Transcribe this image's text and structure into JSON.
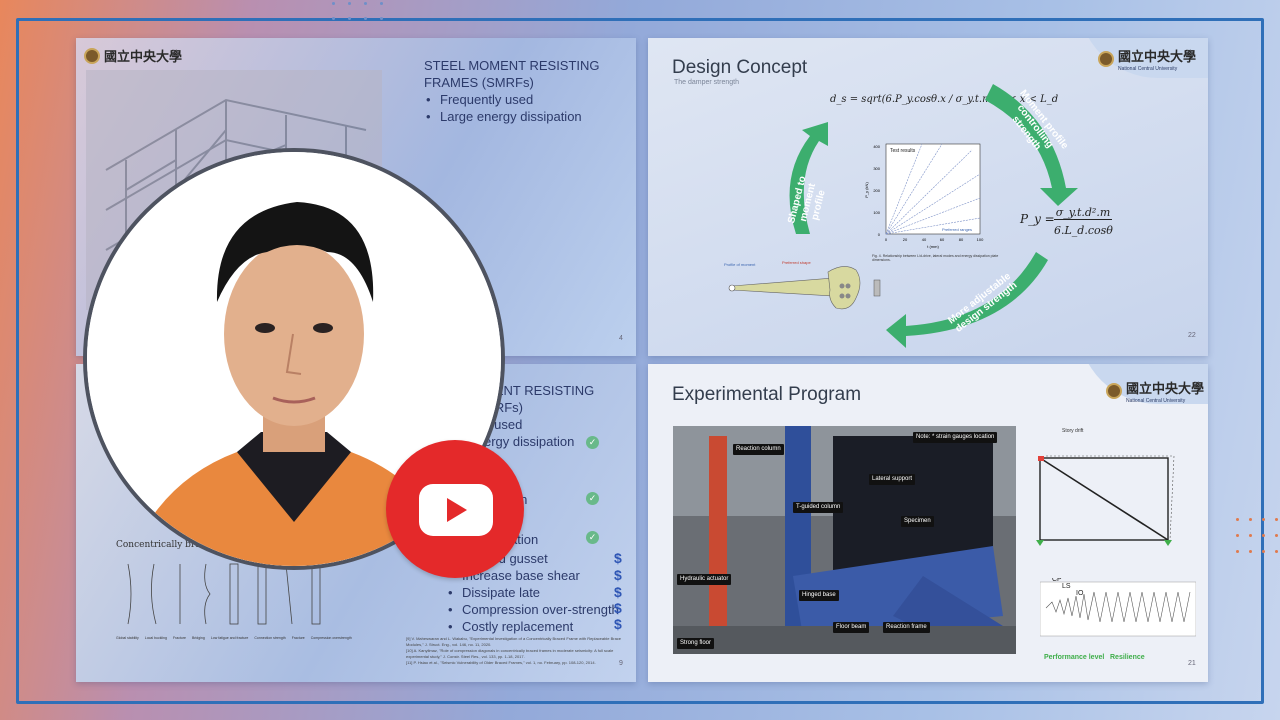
{
  "slide_a": {
    "heading": "STEEL MOMENT RESISTING FRAMES (SMRFs)",
    "bullets": [
      "Frequently used",
      "Large energy dissipation"
    ],
    "page_number": "4"
  },
  "slide_b": {
    "title": "Design Concept",
    "subtitle": "The damper strength",
    "cycle_labels": [
      "Moment profile controlling strength",
      "More adjustable design strength",
      "Shaped to moment profile"
    ],
    "chart_legend": "Test results",
    "chart_xlabel": "t (mm)",
    "chart_ylabel": "P_y (kN)",
    "chart_yticks": [
      "400",
      "300",
      "200",
      "100",
      "0"
    ],
    "chart_xticks": [
      "0",
      "20",
      "40",
      "60",
      "80",
      "100"
    ],
    "chart_note": "Preferred ranges",
    "figure_caption": "Fig. 4. Relationship between L/d-drive, lateral modes and energy dissipation plate dimensions.",
    "diagram_labels": [
      "Profile of moment",
      "Preferred shape"
    ],
    "formula_left": "d_s = sqrt(6.P_y.cosθ.x / σ_y.t.m) 0 < x < L_d",
    "formula_right_num": "σ_y.t.d².m",
    "formula_right_den": "6.L_d.cosθ",
    "formula_right_lhs": "P_y =",
    "page_number": "22"
  },
  "slide_c": {
    "heading_lines": [
      "MENT RESISTING",
      "MRFs)"
    ],
    "bullets_partial": [
      "y used",
      "ergy dissipation"
    ],
    "section2_partial": [
      "ES",
      "rmation",
      "ATED",
      "issipation"
    ],
    "bullets": [
      "Welded gusset",
      "Increase base shear",
      "Dissipate late",
      "Compression over-strength",
      "Costly replacement"
    ],
    "caption_left": "Concentrically braced Frame (CBF)",
    "brace_labels": [
      "Global stability",
      "Local buckling",
      "Fracture",
      "Bridging",
      "Low fatigue and fracture",
      "Connection strength",
      "Fracture",
      "Compression overstrength"
    ],
    "references": [
      "[9] V. Maheswaran and L. Wakabu, \"Experimental Investigation of a Concentrically Braced Frame with Replaceable Brace Modules,\" J. Struct. Eng., vol. 146, no. 11, 2020.",
      "[10] A. Kanyilmaz, \"Role of compression diagonals in concentrically braced frames in moderate seismicity: A full scale experimental study,\" J. Constr. Steel Res., vol. 133, pp. 1-18, 2017.",
      "[11] P. Hsiao et al., \"Seismic Vulnerability of Older Braced Frames,\" vol. 1, no. February, pp. 108-120, 2014."
    ],
    "page_number": "9"
  },
  "slide_d": {
    "title": "Experimental Program",
    "photo_labels": [
      "Reaction column",
      "T-guided column",
      "Lateral support",
      "Specimen",
      "Hydraulic actuator",
      "Hinged base",
      "Floor beam",
      "Reaction frame",
      "Strong floor"
    ],
    "note": "Note: * strain gauges location",
    "right_labels": [
      "Story drift",
      "Performance level",
      "Resilience"
    ],
    "hysteresis_marks": [
      "CP",
      "LS",
      "IO"
    ],
    "page_number": "21"
  },
  "logo": {
    "name": "國立中央大學",
    "sub": "National Central University"
  },
  "colors": {
    "accent": "#2f6fb8",
    "youtube_red": "#e4292a",
    "green_arrow": "#3cae6e"
  },
  "icons": {
    "youtube": "youtube-play-icon",
    "check": "check-circle-icon",
    "dollar": "dollar-icon"
  }
}
